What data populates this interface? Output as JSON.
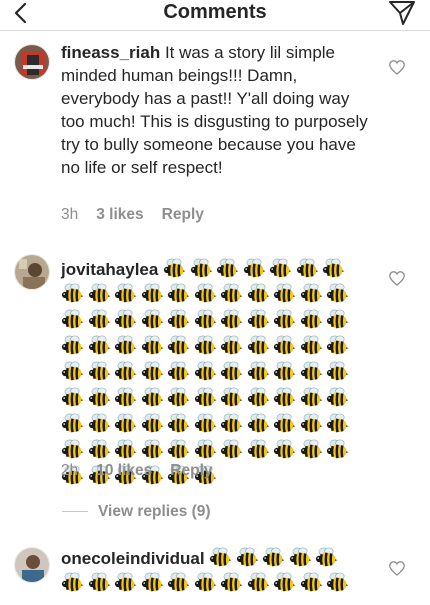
{
  "header": {
    "title": "Comments",
    "back_icon": "chevron-left-icon",
    "share_icon": "paper-plane-icon"
  },
  "comments": [
    {
      "username": "fineass_riah",
      "text": " It was a story lil simple minded human beings!!! Damn, everybody has a past!! Y'all doing way too much! This is disgusting to purposely try to bully someone because you have no life or self respect!",
      "time": "3h",
      "likes": "3 likes",
      "reply": "Reply"
    },
    {
      "username": "jovitahaylea",
      "bee_rows": [
        7,
        11,
        11,
        11,
        11,
        11,
        11,
        11,
        6
      ],
      "time": "2h",
      "likes": "10 likes",
      "reply": "Reply",
      "view_replies": "View replies (9)"
    },
    {
      "username": "onecoleindividual",
      "bee_rows": [
        5,
        11
      ]
    }
  ],
  "colors": {
    "text": "#262626",
    "meta": "#8e8e8e",
    "divider": "#dbdbdb"
  }
}
